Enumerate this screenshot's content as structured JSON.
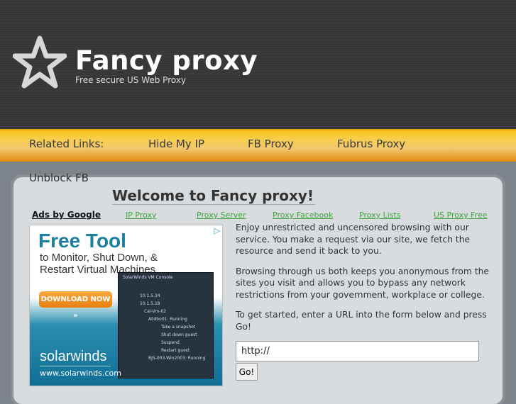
{
  "site": {
    "title": "Fancy proxy",
    "tagline": "Free secure US Web Proxy"
  },
  "nav": {
    "label": "Related Links:",
    "links": [
      "Hide My IP",
      "FB Proxy",
      "Fubrus Proxy"
    ]
  },
  "unblock": "Unblock FB",
  "welcome": "Welcome to Fancy proxy!",
  "ads": {
    "label": "Ads by Google",
    "links": [
      "IP Proxy",
      "Proxy Server",
      "Proxy Facebook",
      "Proxy Lists",
      "US Proxy Free"
    ]
  },
  "banner": {
    "headline": "Free Tool",
    "sub": "to Monitor, Shut Down, & Restart Virtual Machines",
    "button": "DOWNLOAD NOW »",
    "brand": "solarwinds",
    "url": "www.solarwinds.com",
    "console_title": "SolarWinds VM Console",
    "console_rows": [
      "10.1.5.34",
      "10.1.5.18",
      "Cal-Vm-02",
      "Alldbo01: Running",
      "Take a snapshot",
      "Shut down guest",
      "Suspend",
      "Restart guest",
      "BJS-003-Win2003: Running"
    ]
  },
  "intro": [
    "Enjoy unrestricted and uncensored browsing with our service. You make a request via our site, we fetch the resource and send it back to you.",
    "Browsing through us both keeps you anonymous from the sites you visit and allows you to bypass any network restrictions from your government, workplace or college.",
    "To get started, enter a URL into the form below and press Go!"
  ],
  "form": {
    "url_value": "http://",
    "go_label": "Go!"
  }
}
